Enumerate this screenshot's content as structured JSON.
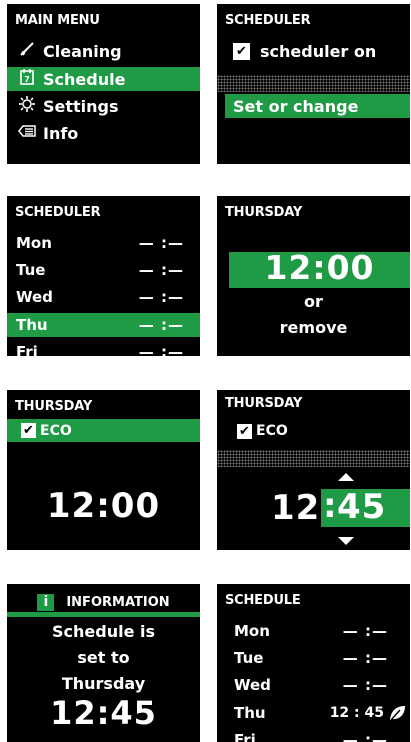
{
  "colors": {
    "green": "#1f9a45",
    "screen": "#000000"
  },
  "panel_main_menu": {
    "header": "MAIN MENU",
    "items": [
      {
        "icon": "broom-icon",
        "glyph": "⚟",
        "label": "Cleaning"
      },
      {
        "icon": "calendar-icon",
        "glyph": "7",
        "label": "Schedule"
      },
      {
        "icon": "settings-icon",
        "glyph": "☼",
        "label": "Settings"
      },
      {
        "icon": "info-icon",
        "glyph": "⌫",
        "label": "Info"
      }
    ]
  },
  "panel_scheduler": {
    "header": "SCHEDULER",
    "checkbox_label": "scheduler on",
    "action": "Set or change"
  },
  "panel_scheduler_list": {
    "header": "SCHEDULER",
    "days": [
      {
        "day": "Mon",
        "time": "— :—"
      },
      {
        "day": "Tue",
        "time": "— :—"
      },
      {
        "day": "Wed",
        "time": "— :—"
      },
      {
        "day": "Thu",
        "time": "— :—"
      },
      {
        "day": "Fri",
        "time": "— :—"
      }
    ]
  },
  "panel_thursday_time": {
    "header": "THURSDAY",
    "time": "12:00",
    "or": "or",
    "remove": "remove"
  },
  "panel_thursday_eco": {
    "header": "THURSDAY",
    "eco_label": "ECO",
    "time": "12:00"
  },
  "panel_thursday_edit": {
    "header": "THURSDAY",
    "eco_label": "ECO",
    "hours": "12",
    "minutes": "45"
  },
  "panel_information": {
    "header": "INFORMATION",
    "line1": "Schedule is",
    "line2": "set to",
    "line3": "Thursday",
    "time": "12:45"
  },
  "panel_schedule": {
    "header": "SCHEDULE",
    "days": [
      {
        "day": "Mon",
        "time": "— :—"
      },
      {
        "day": "Tue",
        "time": "— :—"
      },
      {
        "day": "Wed",
        "time": "— :—"
      },
      {
        "day": "Thu",
        "time": "12 : 45"
      },
      {
        "day": "Fri",
        "time": "— :—"
      }
    ]
  }
}
